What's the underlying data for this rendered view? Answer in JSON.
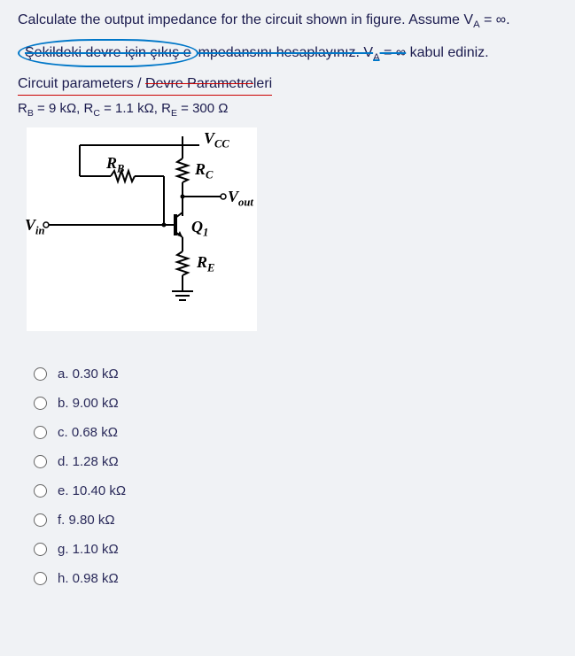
{
  "question": {
    "line1_a": "Calculate the output impedance for the circuit shown in figure. Assume V",
    "line1_sub": "A",
    "line1_b": " = ∞.",
    "line2_a": "Şekildeki devre için çıkış e",
    "line2_b": "mpedansını hesaplayınız. V",
    "line2_sub": "A",
    "line2_c": " = ∞",
    "line2_d": " kabul ediniz.",
    "line3_a": "Circuit parameters / ",
    "line3_b": "Devre Parametre",
    "line3_c": "leri"
  },
  "params": {
    "text_a": "R",
    "sub_b": "B",
    "text_b": " = 9 kΩ, R",
    "sub_c": "C",
    "text_c": " = 1.1 kΩ, R",
    "sub_e": "E",
    "text_d": " = 300 Ω"
  },
  "circuit": {
    "vcc": "V",
    "vcc_sub": "CC",
    "rb": "R",
    "rb_sub": "B",
    "rc": "R",
    "rc_sub": "C",
    "vout": "V",
    "vout_sub": "out",
    "vin": "V",
    "vin_sub": "in",
    "q1": "Q",
    "q1_sub": "1",
    "re": "R",
    "re_sub": "E"
  },
  "options": [
    {
      "label": "a. 0.30 kΩ"
    },
    {
      "label": "b. 9.00 kΩ"
    },
    {
      "label": "c. 0.68 kΩ"
    },
    {
      "label": "d. 1.28 kΩ"
    },
    {
      "label": "e. 10.40 kΩ"
    },
    {
      "label": "f. 9.80 kΩ"
    },
    {
      "label": "g. 1.10 kΩ"
    },
    {
      "label": "h. 0.98 kΩ"
    }
  ]
}
